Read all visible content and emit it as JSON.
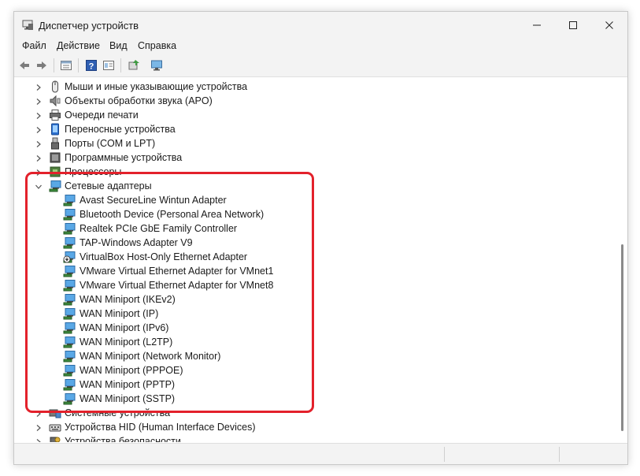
{
  "window": {
    "title": "Диспетчер устройств"
  },
  "menu": [
    "Файл",
    "Действие",
    "Вид",
    "Справка"
  ],
  "toolbar": {
    "icons": [
      "back-arrow-icon",
      "forward-arrow-icon",
      "properties-icon",
      "help-icon",
      "details-icon",
      "update-driver-icon",
      "monitor-icon"
    ]
  },
  "tree": {
    "top_items": [
      {
        "label": "Мыши и иные указывающие устройства",
        "icon": "mouse-icon"
      },
      {
        "label": "Объекты обработки звука (APO)",
        "icon": "speaker-icon"
      },
      {
        "label": "Очереди печати",
        "icon": "printer-icon"
      },
      {
        "label": "Переносные устройства",
        "icon": "portable-device-icon"
      },
      {
        "label": "Порты (COM и LPT)",
        "icon": "port-icon"
      },
      {
        "label": "Программные устройства",
        "icon": "software-device-icon"
      },
      {
        "label": "Процессоры",
        "icon": "processor-icon"
      }
    ],
    "network": {
      "label": "Сетевые адаптеры",
      "icon": "network-adapter-icon",
      "expanded": true,
      "children": [
        "Avast SecureLine Wintun Adapter",
        "Bluetooth Device (Personal Area Network)",
        "Realtek PCIe GbE Family Controller",
        "TAP-Windows Adapter V9",
        "VirtualBox Host-Only Ethernet Adapter",
        "VMware Virtual Ethernet Adapter for VMnet1",
        "VMware Virtual Ethernet Adapter for VMnet8",
        "WAN Miniport (IKEv2)",
        "WAN Miniport (IP)",
        "WAN Miniport (IPv6)",
        "WAN Miniport (L2TP)",
        "WAN Miniport (Network Monitor)",
        "WAN Miniport (PPPOE)",
        "WAN Miniport (PPTP)",
        "WAN Miniport (SSTP)"
      ]
    },
    "bottom_items": [
      {
        "label": "Системные устройства",
        "icon": "system-device-icon"
      },
      {
        "label": "Устройства HID (Human Interface Devices)",
        "icon": "hid-icon"
      },
      {
        "label": "Устройства безопасности",
        "icon": "security-device-icon"
      }
    ]
  },
  "colors": {
    "highlight": "#e3212b",
    "chrome": "#f3f3f3"
  }
}
